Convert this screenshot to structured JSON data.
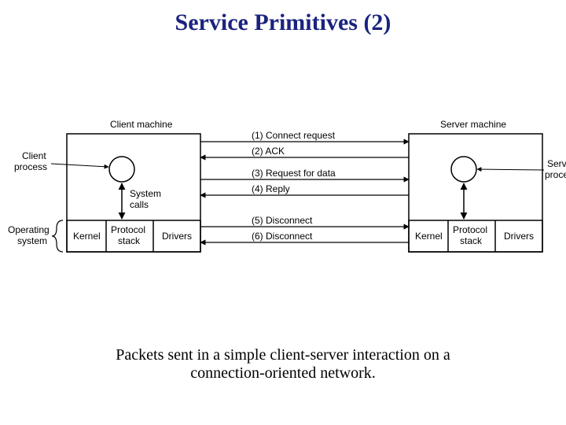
{
  "title": "Service Primitives (2)",
  "caption_line1": "Packets sent in a simple client-server interaction on a",
  "caption_line2": "connection-oriented network.",
  "diagram": {
    "client_machine_label": "Client machine",
    "server_machine_label": "Server machine",
    "client_process_label_l1": "Client",
    "client_process_label_l2": "process",
    "server_process_label_l1": "Server",
    "server_process_label_l2": "process",
    "system_calls_label_l1": "System",
    "system_calls_label_l2": "calls",
    "operating_system_label_l1": "Operating",
    "operating_system_label_l2": "system",
    "kernel_label": "Kernel",
    "protocol_stack_label_l1": "Protocol",
    "protocol_stack_label_l2": "stack",
    "drivers_label": "Drivers",
    "msg1": "(1) Connect request",
    "msg2": "(2) ACK",
    "msg3": "(3) Request for data",
    "msg4": "(4) Reply",
    "msg5": "(5) Disconnect",
    "msg6": "(6) Disconnect"
  }
}
